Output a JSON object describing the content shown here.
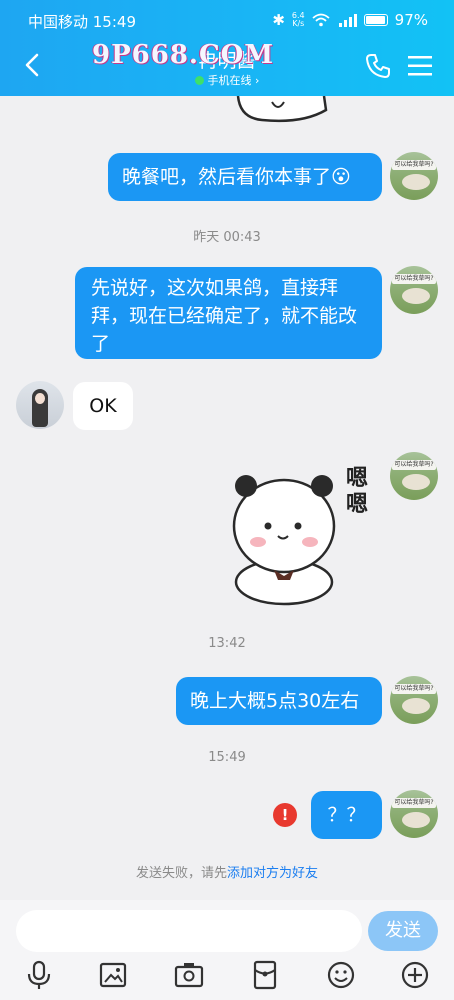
{
  "status_bar": {
    "carrier_time": "中国移动 15:49",
    "net_speed_value": "6.4",
    "net_speed_unit": "K/s",
    "battery": "97%"
  },
  "header": {
    "title": "冉明酱",
    "subtitle": "手机在线 ›",
    "watermark": "9P668.COM"
  },
  "messages": [
    {
      "from": "me",
      "type": "text",
      "text": "晚餐吧，然后看你本事了😮"
    },
    {
      "type": "time",
      "text": "昨天 00:43"
    },
    {
      "from": "me",
      "type": "text",
      "text": "先说好，这次如果鸽，直接拜拜，现在已经确定了，就不能改了"
    },
    {
      "from": "them",
      "type": "text",
      "text": "OK"
    },
    {
      "from": "me",
      "type": "sticker",
      "text": "嗯嗯"
    },
    {
      "type": "time",
      "text": "13:42"
    },
    {
      "from": "me",
      "type": "text",
      "text": "晚上大概5点30左右"
    },
    {
      "type": "time",
      "text": "15:49"
    },
    {
      "from": "me",
      "type": "text",
      "text": "？？",
      "failed": true
    }
  ],
  "avatar_me_sign": "可以给我草吗?",
  "notice": {
    "prefix": "发送失败，请先",
    "link": "添加对方为好友"
  },
  "input": {
    "placeholder": "",
    "send_label": "发送"
  },
  "toolbar": [
    "mic-icon",
    "image-icon",
    "camera-icon",
    "red-packet-icon",
    "emoji-icon",
    "plus-icon"
  ],
  "colors": {
    "header": "#1ea6f2",
    "my_bubble": "#1b97f4",
    "their_bubble": "#ffffff",
    "link": "#1b7ef0",
    "send_button": "#8cc6f7",
    "fail": "#e8392f"
  }
}
